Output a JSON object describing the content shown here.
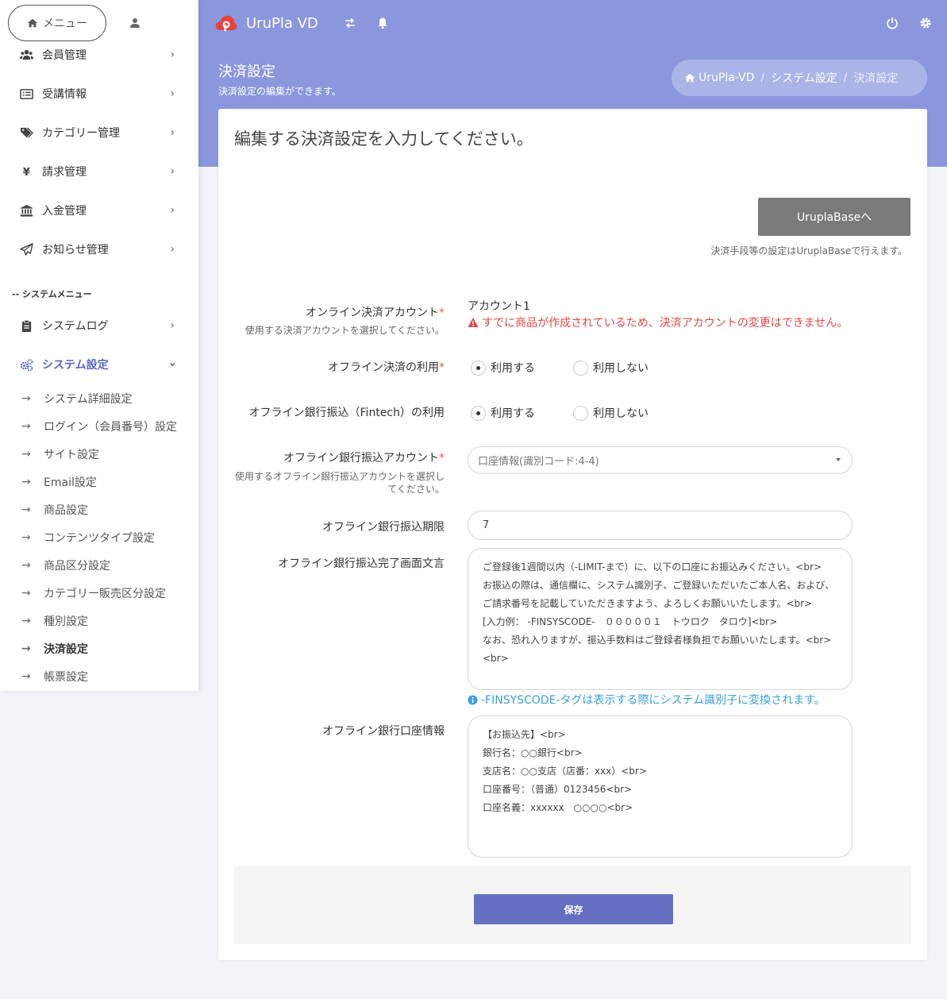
{
  "sidebar": {
    "menu_label": "メニュー",
    "items": [
      {
        "label": "会員管理",
        "icon": "users-icon"
      },
      {
        "label": "受講情報",
        "icon": "list-icon"
      },
      {
        "label": "カテゴリー管理",
        "icon": "tags-icon"
      },
      {
        "label": "請求管理",
        "icon": "yen-icon"
      },
      {
        "label": "入金管理",
        "icon": "bank-icon"
      },
      {
        "label": "お知らせ管理",
        "icon": "paper-plane-icon"
      }
    ],
    "system_heading": "-- システムメニュー",
    "system_items": [
      {
        "label": "システムログ",
        "icon": "clipboard-icon"
      },
      {
        "label": "システム設定",
        "icon": "cogs-icon"
      }
    ],
    "sub_items": [
      "システム詳細設定",
      "ログイン（会員番号）設定",
      "サイト設定",
      "Email設定",
      "商品設定",
      "コンテンツタイプ設定",
      "商品区分設定",
      "カテゴリー販売区分設定",
      "種別設定",
      "決済設定",
      "帳票設定"
    ],
    "arrow": "→"
  },
  "header": {
    "brand": "UruPla VD",
    "page_title": "決済設定",
    "page_subtitle": "決済設定の編集ができます。",
    "breadcrumb": [
      "UruPla-VD",
      "システム設定",
      "決済設定"
    ],
    "breadcrumb_sep": "/"
  },
  "form": {
    "card_title": "編集する決済設定を入力してください。",
    "base_button": "UruplaBaseへ",
    "base_note": "決済手段等の設定はUruplaBaseで行えます。",
    "online_account_label": "オンライン決済アカウント",
    "online_account_hint": "使用する決済アカウントを選択してください。",
    "online_account_value": "アカウント1",
    "online_account_warning": "すでに商品が作成されているため、決済アカウントの変更はできません。",
    "offline_use_label": "オフライン決済の利用",
    "fintech_label": "オフライン銀行振込（Fintech）の利用",
    "radio_use": "利用する",
    "radio_not_use": "利用しない",
    "bank_account_label": "オフライン銀行振込アカウント",
    "bank_account_hint": "使用するオフライン銀行振込アカウントを選択してください。",
    "bank_account_value": "口座情報(識別コード:4-4)",
    "deadline_label": "オフライン銀行振込期限",
    "deadline_value": "7",
    "complete_text_label": "オフライン銀行振込完了画面文言",
    "complete_text_value": "ご登録後1週間以内（-LIMIT-まで）に、以下の口座にお振込みください。<br>\nお振込の際は、通信欄に、システム識別子、ご登録いただいたご本人名、および、\nご請求番号を記載していただきますよう、よろしくお願いいたします。<br>\n[入力例： -FINSYSCODE-　０００００１　トウロク　タロウ]<br>\nなお、恐れ入りますが、振込手数料はご登録者様負担でお願いいたします。<br>\n<br>",
    "info_note": "-FINSYSCODE-タグは表示する際にシステム識別子に変換されます。",
    "bank_info_label": "オフライン銀行口座情報",
    "bank_info_value": "【お振込先】<br>\n銀行名：○○銀行<br>\n支店名：○○支店（店番：xxx）<br>\n口座番号：（普通）0123456<br>\n口座名義：xxxxxx　○○○○<br>",
    "save_button": "保存",
    "required_mark": "*"
  },
  "colors": {
    "header_bg": "#8a97dd",
    "accent": "#5866c4",
    "save_bg": "#6470bf",
    "warning": "#e04848",
    "info": "#3a9fd8"
  }
}
